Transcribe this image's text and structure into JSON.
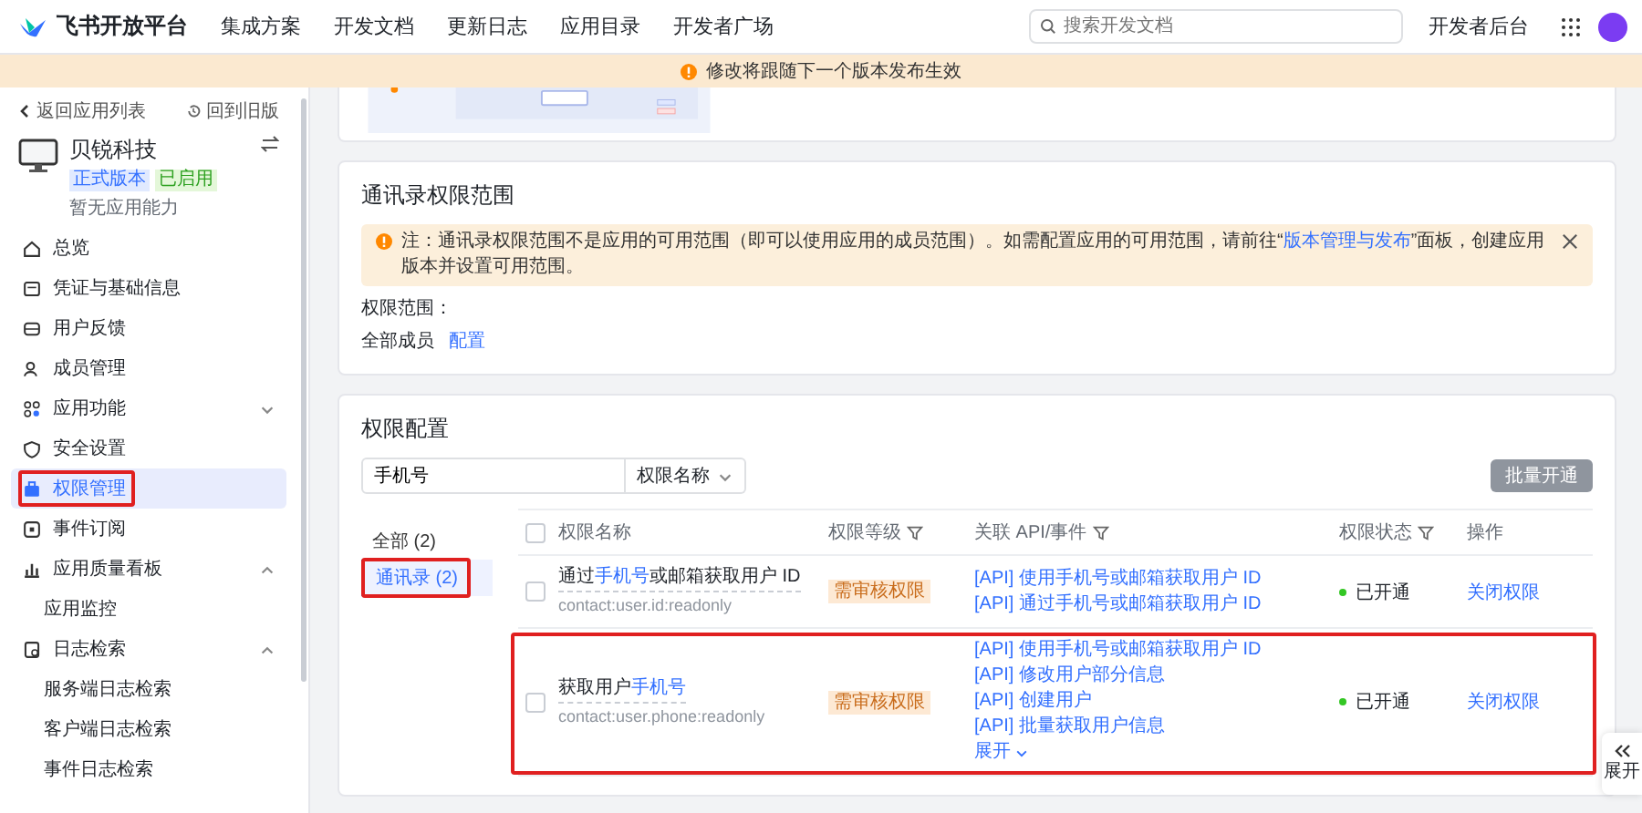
{
  "header": {
    "brand": "飞书开放平台",
    "nav": [
      "集成方案",
      "开发文档",
      "更新日志",
      "应用目录",
      "开发者广场"
    ],
    "search": {
      "placeholder": "搜索开发文档"
    },
    "console_link": "开发者后台"
  },
  "banner": {
    "text": "修改将跟随下一个版本发布生效"
  },
  "sidebar": {
    "back": "返回应用列表",
    "old_version": "回到旧版",
    "app": {
      "name": "贝锐科技",
      "tags": [
        {
          "label": "正式版本",
          "kind": "version"
        },
        {
          "label": "已启用",
          "kind": "status"
        }
      ],
      "subtitle": "暂无应用能力"
    },
    "items": [
      {
        "label": "总览",
        "selected": false,
        "highlighted": false
      },
      {
        "label": "凭证与基础信息",
        "selected": false,
        "highlighted": false
      },
      {
        "label": "用户反馈",
        "selected": false,
        "highlighted": false
      },
      {
        "label": "成员管理",
        "selected": false,
        "highlighted": false
      },
      {
        "label": "应用功能",
        "selected": false,
        "highlighted": false,
        "expanded": false
      },
      {
        "label": "安全设置",
        "selected": false,
        "highlighted": false
      },
      {
        "label": "权限管理",
        "selected": true,
        "highlighted": true
      },
      {
        "label": "事件订阅",
        "selected": false,
        "highlighted": false
      },
      {
        "label": "应用质量看板",
        "selected": false,
        "highlighted": false,
        "expanded": true,
        "children": [
          {
            "label": "应用监控",
            "selected": false
          }
        ]
      },
      {
        "label": "日志检索",
        "selected": false,
        "highlighted": false,
        "expanded": true,
        "children": [
          {
            "label": "服务端日志检索",
            "selected": false
          },
          {
            "label": "客户端日志检索",
            "selected": false
          },
          {
            "label": "事件日志检索",
            "selected": false
          }
        ]
      }
    ]
  },
  "contact_scope": {
    "title": "通讯录权限范围",
    "alert": {
      "before": "注：通讯录权限范围不是应用的可用范围（即可以使用应用的成员范围）。如需配置应用的可用范围，请前往“",
      "link": "版本管理与发布",
      "after": "”面板，创建应用版本并设置可用范围。"
    },
    "scope_label": "权限范围：",
    "scope_value": "全部成员",
    "configure_link": "配置"
  },
  "permissions": {
    "title": "权限配置",
    "search": {
      "value": "手机号"
    },
    "search_type": "权限名称",
    "batch_button": {
      "label": "批量开通",
      "disabled": true
    },
    "categories": [
      {
        "label": "全部 (2)",
        "selected": false,
        "highlighted": false
      },
      {
        "label": "通讯录 (2)",
        "selected": true,
        "highlighted": true
      }
    ],
    "table": {
      "header_checked": false,
      "columns": [
        {
          "label": "权限名称",
          "filter": false
        },
        {
          "label": "权限等级",
          "filter": true
        },
        {
          "label": "关联 API/事件",
          "filter": true
        },
        {
          "label": "权限状态",
          "filter": true
        },
        {
          "label": "操作",
          "filter": false
        }
      ],
      "rows": [
        {
          "checked": false,
          "highlighted": false,
          "name": [
            {
              "text": "通过",
              "match": false
            },
            {
              "text": "手机号",
              "match": true
            },
            {
              "text": "或邮箱获取用户 ID",
              "match": false
            }
          ],
          "scope": "contact:user.id:readonly",
          "level": "需审核权限",
          "apis": [
            "[API] 使用手机号或邮箱获取用户 ID",
            "[API] 通过手机号或邮箱获取用户 ID"
          ],
          "status": "已开通",
          "enabled": true,
          "action": "关闭权限"
        },
        {
          "checked": false,
          "highlighted": true,
          "name": [
            {
              "text": "获取用户",
              "match": false
            },
            {
              "text": "手机号",
              "match": true
            }
          ],
          "scope": "contact:user.phone:readonly",
          "level": "需审核权限",
          "apis": [
            "[API] 使用手机号或邮箱获取用户 ID",
            "[API] 修改用户部分信息",
            "[API] 创建用户",
            "[API] 批量获取用户信息"
          ],
          "more": "展开",
          "status": "已开通",
          "enabled": true,
          "action": "关闭权限"
        }
      ]
    }
  },
  "side_toggle": {
    "label": "展开"
  }
}
